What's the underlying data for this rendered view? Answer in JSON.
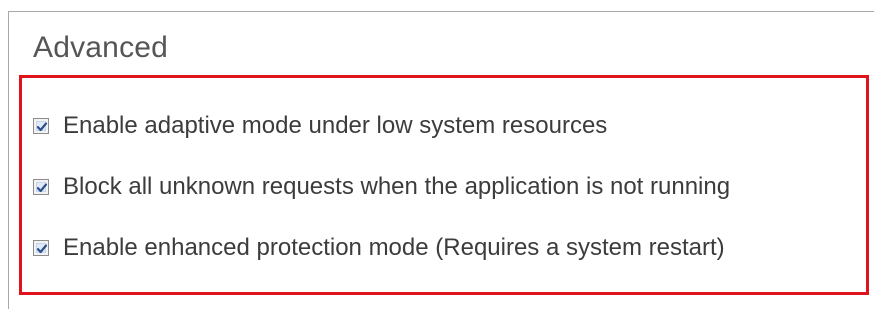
{
  "section": {
    "title": "Advanced"
  },
  "options": [
    {
      "label": "Enable adaptive mode under low system resources",
      "checked": true,
      "icon": "checkbox-checked-icon"
    },
    {
      "label": "Block all unknown requests when the application is not running",
      "checked": true,
      "icon": "checkbox-checked-icon"
    },
    {
      "label": "Enable enhanced protection mode (Requires a system restart)",
      "checked": true,
      "icon": "checkbox-checked-icon"
    }
  ],
  "colors": {
    "highlight_border": "#e0121c",
    "checkmark": "#2a4f8a",
    "title_text": "#555555",
    "label_text": "#3c3c3c"
  }
}
